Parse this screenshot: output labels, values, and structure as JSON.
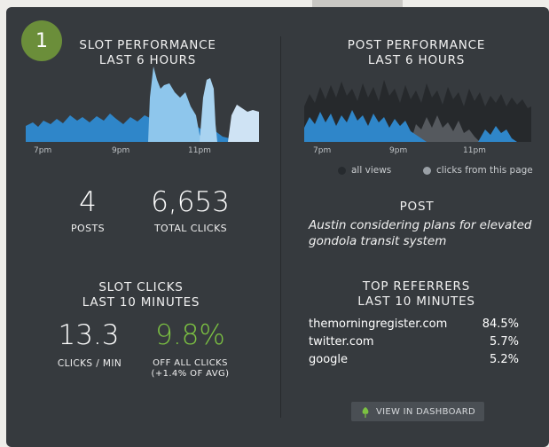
{
  "badge": "1",
  "slot_performance": {
    "title_line1": "SLOT PERFORMANCE",
    "title_line2": "LAST 6 HOURS",
    "time_ticks": [
      "7pm",
      "9pm",
      "11pm"
    ],
    "colors": {
      "dark": "#2f86c9",
      "light": "#8ec6ec",
      "pale": "#cfe3f4"
    }
  },
  "post_performance": {
    "title_line1": "POST PERFORMANCE",
    "title_line2": "LAST 6 HOURS",
    "time_ticks": [
      "7pm",
      "9pm",
      "11pm"
    ],
    "legend": [
      {
        "label": "all views",
        "color": "#262a2e"
      },
      {
        "label": "clicks from this page",
        "color": "#9aa0a6"
      }
    ]
  },
  "stats": {
    "posts_value": "4",
    "posts_label": "POSTS",
    "clicks_value": "6,653",
    "clicks_label": "TOTAL CLICKS"
  },
  "slot_clicks": {
    "title_line1": "SLOT CLICKS",
    "title_line2": "LAST 10 MINUTES",
    "rate_value": "13.3",
    "rate_label": "CLICKS / MIN",
    "pct_value": "9.8%",
    "pct_color": "#7cc242",
    "pct_label_line1": "OFF ALL CLICKS",
    "pct_label_line2": "(+1.4% OF AVG)"
  },
  "post": {
    "heading": "POST",
    "title_line1": "Austin considering plans for elevated",
    "title_line2": "gondola transit system"
  },
  "referrers": {
    "title_line1": "TOP REFERRERS",
    "title_line2": "LAST 10 MINUTES",
    "items": [
      {
        "name": "themorningregister.com",
        "pct": "84.5%"
      },
      {
        "name": "twitter.com",
        "pct": "5.7%"
      },
      {
        "name": "google",
        "pct": "5.2%"
      }
    ]
  },
  "dashboard_button": "VIEW IN DASHBOARD"
}
